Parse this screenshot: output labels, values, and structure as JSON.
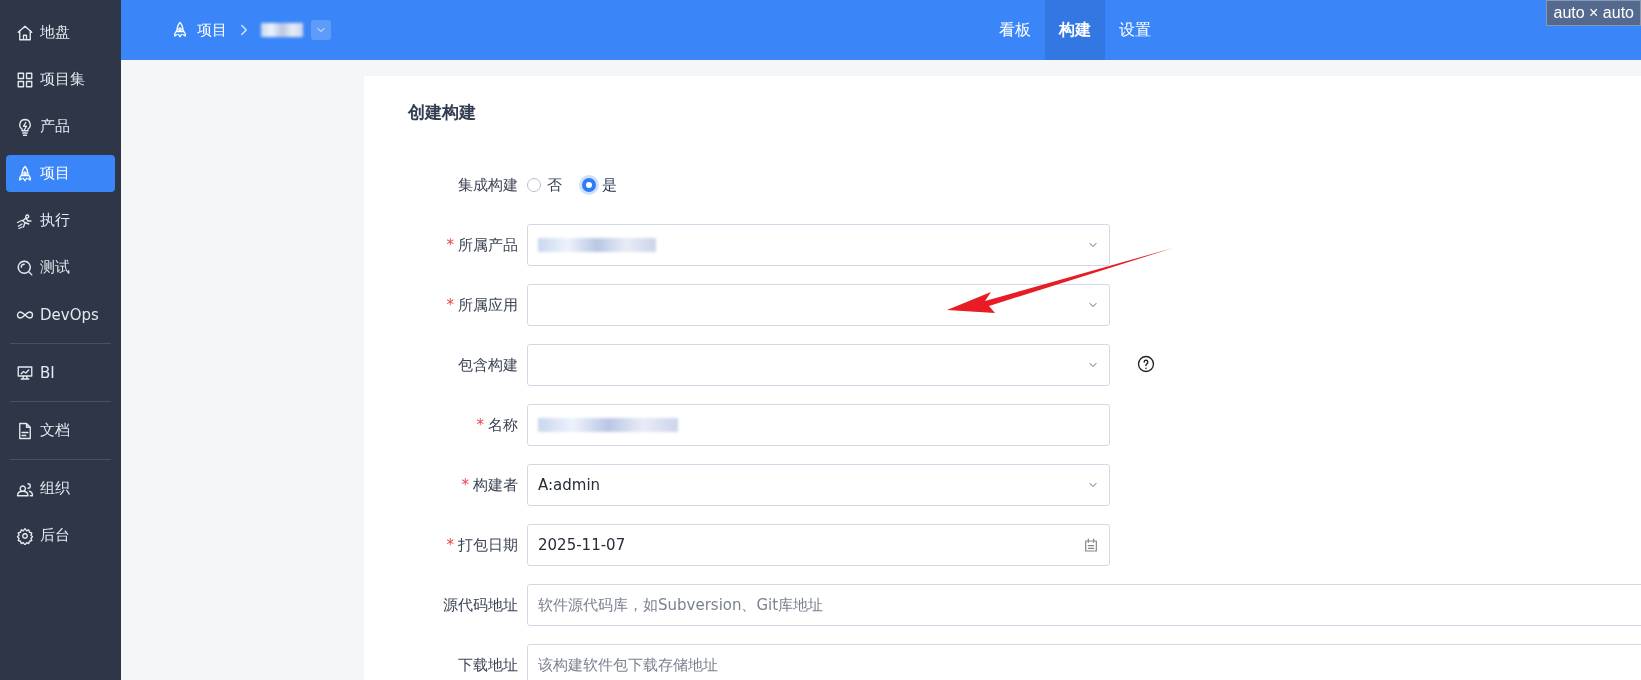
{
  "sidebar": {
    "groups": [
      [
        {
          "label": "地盘",
          "selected": false
        },
        {
          "label": "项目集",
          "selected": false
        },
        {
          "label": "产品",
          "selected": false
        },
        {
          "label": "项目",
          "selected": true
        },
        {
          "label": "执行",
          "selected": false
        },
        {
          "label": "测试",
          "selected": false
        },
        {
          "label": "DevOps",
          "selected": false
        }
      ],
      [
        {
          "label": "BI",
          "selected": false
        }
      ],
      [
        {
          "label": "文档",
          "selected": false
        }
      ],
      [
        {
          "label": "组织",
          "selected": false
        },
        {
          "label": "后台",
          "selected": false
        }
      ]
    ]
  },
  "topbar": {
    "breadcrumb": {
      "root": "项目",
      "current_redacted": true
    },
    "tabs": [
      {
        "label": "看板",
        "selected": false
      },
      {
        "label": "构建",
        "selected": true
      },
      {
        "label": "设置",
        "selected": false
      }
    ],
    "size_badge": "auto × auto"
  },
  "form": {
    "title": "创建构建",
    "fields": [
      {
        "kind": "radio",
        "label": "集成构建",
        "options": [
          {
            "label": "否",
            "selected": false
          },
          {
            "label": "是",
            "selected": true
          }
        ]
      },
      {
        "kind": "select",
        "label": "所属产品",
        "required_mark": "*",
        "redacted": true
      },
      {
        "kind": "select",
        "label": "所属应用",
        "required_mark": "*"
      },
      {
        "kind": "select",
        "label": "包含构建",
        "help": true
      },
      {
        "kind": "text",
        "label": "名称",
        "required_mark": "*",
        "redacted": true
      },
      {
        "kind": "select",
        "label": "构建者",
        "required_mark": "*",
        "value": "A:admin"
      },
      {
        "kind": "date",
        "label": "打包日期",
        "required_mark": "*",
        "value": "2025-11-07"
      },
      {
        "kind": "text",
        "label": "源代码地址",
        "wide": true,
        "placeholder": "软件源代码库，如Subversion、Git库地址"
      },
      {
        "kind": "text",
        "label": "下载地址",
        "wide": true,
        "placeholder": "该构建软件包下载存储地址"
      }
    ]
  }
}
